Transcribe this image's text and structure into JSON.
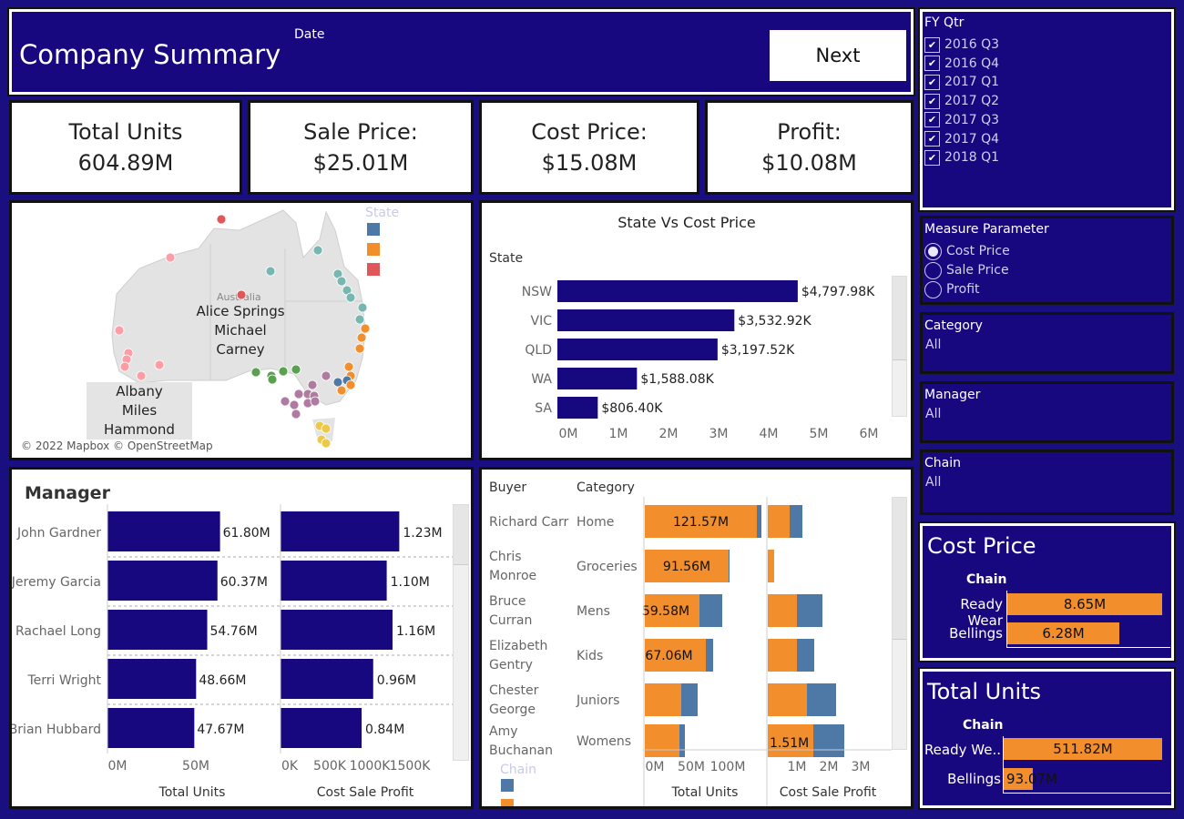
{
  "header": {
    "title": "Company Summary",
    "date_label": "Date",
    "next_label": "Next"
  },
  "kpis": [
    {
      "label": "Total Units",
      "value": "604.89M"
    },
    {
      "label": "Sale Price:",
      "value": "$25.01M"
    },
    {
      "label": "Cost Price:",
      "value": "$15.08M"
    },
    {
      "label": "Profit:",
      "value": "$10.08M"
    }
  ],
  "map": {
    "legend_title": "State",
    "region_label": "Australia",
    "tooltip1": {
      "line1": "Alice Springs",
      "line2": "Michael Carney"
    },
    "tooltip2": {
      "line1": "Albany",
      "line2": "Miles Hammond"
    },
    "copyright": "© 2022 Mapbox © OpenStreetMap",
    "legend_colors": [
      "#4e79a7",
      "#f28e2b",
      "#e15759"
    ]
  },
  "state_chart": {
    "title": "State Vs Cost Price",
    "axis_label": "State",
    "chart_data": {
      "type": "bar",
      "categories": [
        "NSW",
        "VIC",
        "QLD",
        "WA",
        "SA"
      ],
      "values": [
        4797.98,
        3532.92,
        3197.52,
        1588.08,
        806.4
      ],
      "labels": [
        "$4,797.98K",
        "$3,532.92K",
        "$3,197.52K",
        "$1,588.08K",
        "$806.40K"
      ],
      "ticks": [
        "0M",
        "1M",
        "2M",
        "3M",
        "4M",
        "5M",
        "6M"
      ],
      "xlim": [
        0,
        6000
      ]
    }
  },
  "manager_chart": {
    "title": "Manager",
    "managers": [
      "John Gardner",
      "Jeremy Garcia",
      "Rachael Long",
      "Terri Wright",
      "Brian Hubbard"
    ],
    "total_units": {
      "values": [
        61.8,
        60.37,
        54.76,
        48.66,
        47.67
      ],
      "labels": [
        "61.80M",
        "60.37M",
        "54.76M",
        "48.66M",
        "47.67M"
      ],
      "ticks": [
        "0M",
        "50M"
      ],
      "axis_title": "Total Units"
    },
    "cost_sale_profit": {
      "values": [
        1.23,
        1.1,
        1.16,
        0.96,
        0.84
      ],
      "labels": [
        "1.23M",
        "1.10M",
        "1.16M",
        "0.96M",
        "0.84M"
      ],
      "ticks": [
        "0K",
        "500K",
        "1000K",
        "1500K"
      ],
      "axis_title": "Cost Sale Profit"
    }
  },
  "buyer_chart": {
    "buyer_header": "Buyer",
    "category_header": "Category",
    "buyers": [
      "Richard Carr",
      "Chris Monroe",
      "Bruce Curran",
      "Elizabeth Gentry",
      "Chester George",
      "Amy Buchanan"
    ],
    "categories": [
      "Home",
      "Groceries",
      "Mens",
      "Kids",
      "Juniors",
      "Womens"
    ],
    "units_labels": [
      "121.57M",
      "91.56M",
      "59.58M",
      "67.06M",
      "",
      ""
    ],
    "csp_label_last": "1.51M",
    "units_ticks": [
      "0M",
      "50M",
      "100M"
    ],
    "csp_ticks": [
      "1M",
      "2M",
      "3M"
    ],
    "units_title": "Total Units",
    "csp_title": "Cost Sale Profit",
    "legend_title": "Chain"
  },
  "filters": {
    "fy_qtr": {
      "title": "FY Qtr",
      "items": [
        "2016 Q3",
        "2016 Q4",
        "2017 Q1",
        "2017 Q2",
        "2017 Q3",
        "2017 Q4",
        "2018 Q1"
      ]
    },
    "measure": {
      "title": "Measure Parameter",
      "options": [
        "Cost Price",
        "Sale Price",
        "Profit"
      ]
    },
    "category": {
      "title": "Category",
      "value": "All"
    },
    "manager": {
      "title": "Manager",
      "value": "All"
    },
    "chain": {
      "title": "Chain",
      "value": "All"
    }
  },
  "cost_price_card": {
    "title": "Cost Price",
    "chain_label": "Chain",
    "rows": [
      {
        "label": "Ready Wear",
        "value": "8.65M"
      },
      {
        "label": "Bellings",
        "value": "6.28M"
      }
    ]
  },
  "total_units_card": {
    "title": "Total Units",
    "chain_label": "Chain",
    "rows": [
      {
        "label": "Ready We..",
        "value": "511.82M"
      },
      {
        "label": "Bellings",
        "value": "93.07M"
      }
    ]
  }
}
